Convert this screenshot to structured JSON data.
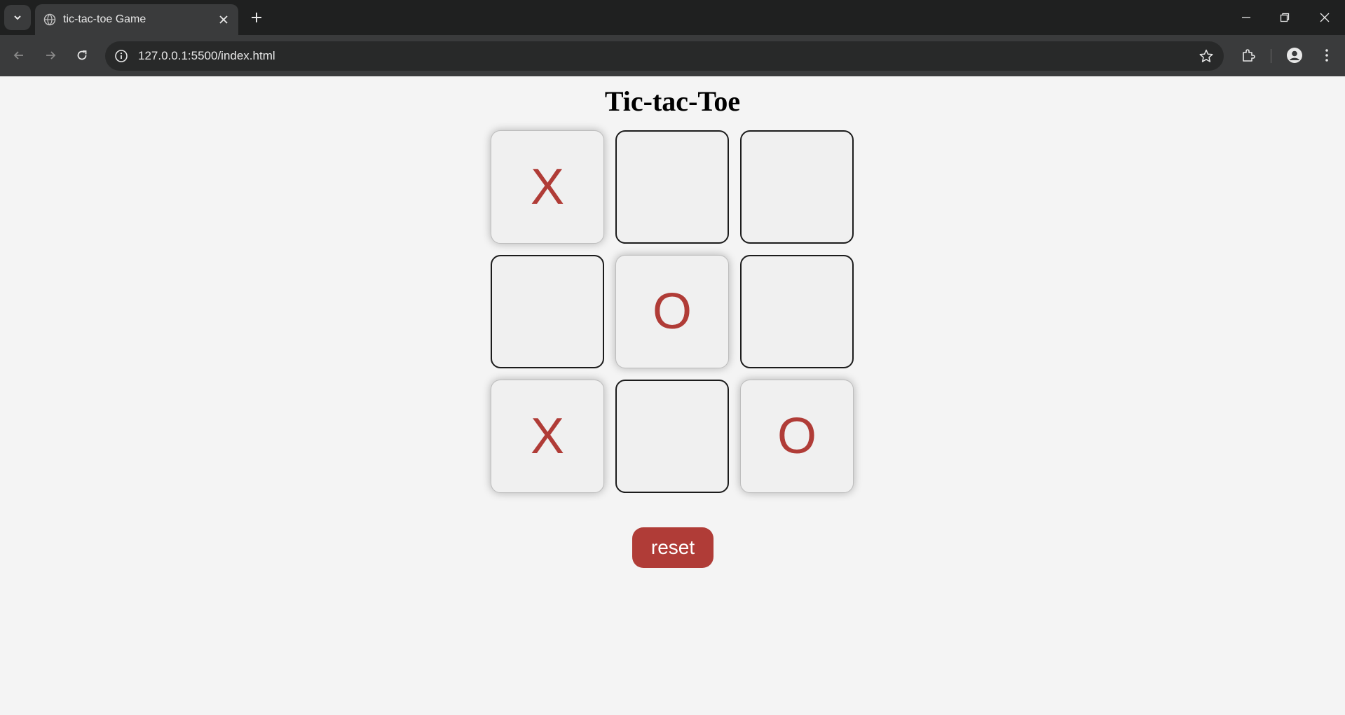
{
  "browser": {
    "tab_title": "tic-tac-toe Game",
    "url": "127.0.0.1:5500/index.html"
  },
  "page": {
    "title": "Tic-tac-Toe",
    "board": [
      {
        "value": "X",
        "filled": true
      },
      {
        "value": "",
        "filled": false
      },
      {
        "value": "",
        "filled": false
      },
      {
        "value": "",
        "filled": false
      },
      {
        "value": "O",
        "filled": true
      },
      {
        "value": "",
        "filled": false
      },
      {
        "value": "X",
        "filled": true
      },
      {
        "value": "",
        "filled": false
      },
      {
        "value": "O",
        "filled": true
      }
    ],
    "reset_label": "reset"
  },
  "colors": {
    "accent": "#b03c37",
    "page_background": "#f4f4f4",
    "chrome_dark": "#1f2020",
    "chrome_toolbar": "#3a3b3c"
  }
}
